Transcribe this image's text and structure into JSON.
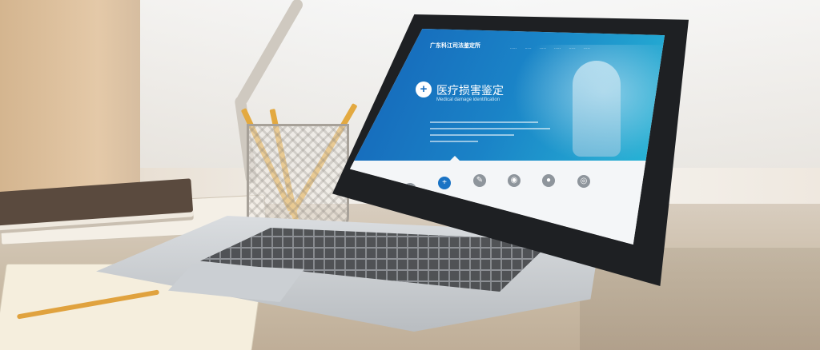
{
  "website": {
    "brand": "广东科江司法鉴定所",
    "hero_title": "医疗损害鉴定",
    "hero_subtitle": "Medical damage identification",
    "services": [
      {
        "icon": "lungs-icon"
      },
      {
        "icon": "plus-icon",
        "active": true
      },
      {
        "icon": "syringe-icon"
      },
      {
        "icon": "eye-icon"
      },
      {
        "icon": "person-icon"
      },
      {
        "icon": "fingerprint-icon"
      }
    ]
  }
}
